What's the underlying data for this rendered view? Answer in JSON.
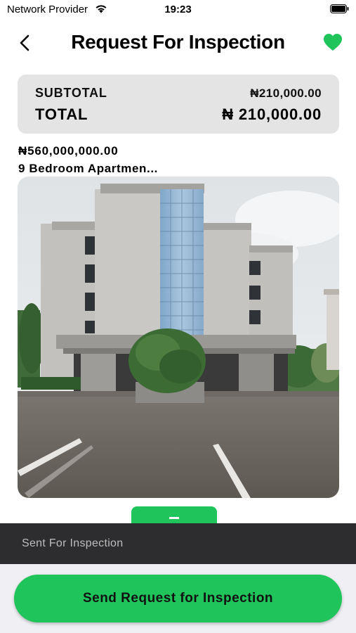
{
  "status_bar": {
    "provider": "Network Provider",
    "time": "19:23"
  },
  "header": {
    "title": "Request For Inspection",
    "back_icon": "chevron-left-icon",
    "favorite_icon": "heart-icon",
    "accent_color": "#1fc45a"
  },
  "totals": {
    "subtotal_label": "SUBTOTAL",
    "subtotal_value": "₦210,000.00",
    "total_label": "TOTAL",
    "total_value": "₦ 210,000.00"
  },
  "property": {
    "price": "₦560,000,000.00",
    "name": "9 Bedroom Apartmen..."
  },
  "toast": {
    "message": "Sent For Inspection"
  },
  "actions": {
    "send_label": "Send Request for Inspection"
  }
}
